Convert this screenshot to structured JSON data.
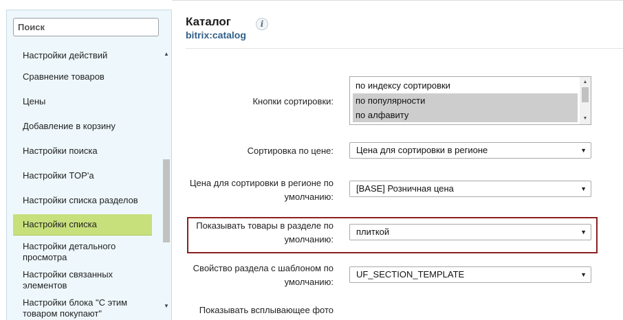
{
  "sidebar": {
    "search_placeholder": "Поиск",
    "items": [
      {
        "label": "Настройки действий"
      },
      {
        "label": "Сравнение товаров"
      },
      {
        "label": "Цены"
      },
      {
        "label": "Добавление в корзину"
      },
      {
        "label": "Настройки поиска"
      },
      {
        "label": "Настройки TOP'а"
      },
      {
        "label": "Настройки списка разделов"
      },
      {
        "label": "Настройки списка"
      },
      {
        "label": "Настройки детального просмотра"
      },
      {
        "label": "Настройки связанных элементов"
      },
      {
        "label": "Настройки блока \"С этим товаром покупают\""
      }
    ],
    "active_item": "Настройки списка"
  },
  "header": {
    "title": "Каталог",
    "subtitle": "bitrix:catalog",
    "info_icon": "info-icon"
  },
  "form": {
    "sort_buttons": {
      "label": "Кнопки сортировки:",
      "options": [
        "по индексу сортировки",
        "по популярности",
        "по алфавиту"
      ]
    },
    "price_sort": {
      "label": "Сортировка по цене:",
      "value": "Цена для сортировки в регионе"
    },
    "region_price_default": {
      "label": "Цена для сортировки в регионе по умолчанию:",
      "value": "[BASE] Розничная цена"
    },
    "section_view_default": {
      "label": "Показывать товары в разделе по умолчанию:",
      "value": "плиткой"
    },
    "section_template_property": {
      "label": "Свойство раздела с шаблоном по умолчанию:",
      "value": "UF_SECTION_TEMPLATE"
    },
    "popup_photo": {
      "label": "Показывать всплывающее фото"
    }
  },
  "colors": {
    "active_item_bg": "#c8e07c",
    "panel_bg": "#eef8fc",
    "highlight_border": "#8b1f1f",
    "subtitle": "#2f5f88"
  }
}
